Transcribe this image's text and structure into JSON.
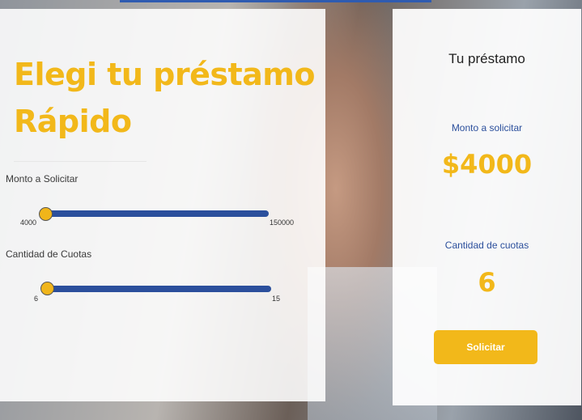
{
  "left": {
    "title_line1": "Elegi tu préstamo",
    "title_line2": "Rápido",
    "amount_slider": {
      "label": "Monto a Solicitar",
      "min_label": "4000",
      "max_label": "150000",
      "min": 4000,
      "max": 150000,
      "value": 4000
    },
    "installments_slider": {
      "label": "Cantidad de Cuotas",
      "min_label": "6",
      "max_label": "15",
      "min": 6,
      "max": 15,
      "value": 6
    }
  },
  "right": {
    "title": "Tu préstamo",
    "amount_label": "Monto a solicitar",
    "amount_value": "$4000",
    "installments_label": "Cantidad de cuotas",
    "installments_value": "6",
    "button_label": "Solicitar"
  },
  "colors": {
    "accent_yellow": "#f2b81a",
    "track_blue": "#2b4f9c"
  }
}
